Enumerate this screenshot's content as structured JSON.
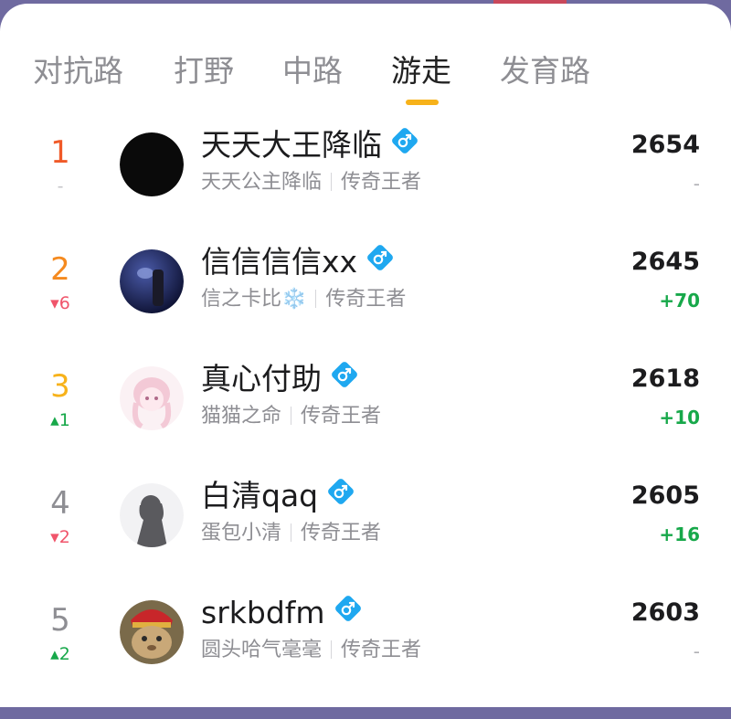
{
  "tabs": [
    {
      "label": "对抗路"
    },
    {
      "label": "打野"
    },
    {
      "label": "中路"
    },
    {
      "label": "游走"
    },
    {
      "label": "发育路"
    }
  ],
  "active_tab": "游走",
  "colors": {
    "rank1": "#f05a28",
    "rank2": "#f58a1f",
    "rank3": "#f7b21a",
    "rank_other": "#8e8e93",
    "up": "#17a84a",
    "down": "#f0556b",
    "verified_badge": "#1fa8f0"
  },
  "players": [
    {
      "rank": "1",
      "trend": "-",
      "trend_dir": "flat",
      "name": "天天大王降临",
      "gender_icon": "male-badge-icon",
      "alias": "天天公主降临",
      "tier": "传奇王者",
      "score": "2654",
      "delta": "-",
      "delta_dir": "flat",
      "avatar": "black-circle"
    },
    {
      "rank": "2",
      "trend": "▾6",
      "trend_dir": "down",
      "name": "信信信信xx",
      "gender_icon": "male-badge-icon",
      "alias": "信之卡比❄️",
      "tier": "传奇王者",
      "score": "2645",
      "delta": "+70",
      "delta_dir": "up",
      "avatar": "dark-blue-photo"
    },
    {
      "rank": "3",
      "trend": "▴1",
      "trend_dir": "up",
      "name": "真心付助",
      "gender_icon": "male-badge-icon",
      "alias": "猫猫之命",
      "tier": "传奇王者",
      "score": "2618",
      "delta": "+10",
      "delta_dir": "up",
      "avatar": "pink-anime-girl"
    },
    {
      "rank": "4",
      "trend": "▾2",
      "trend_dir": "down",
      "name": "白清qaq",
      "gender_icon": "male-badge-icon",
      "alias": "蛋包小清",
      "tier": "传奇王者",
      "score": "2605",
      "delta": "+16",
      "delta_dir": "up",
      "avatar": "silhouette"
    },
    {
      "rank": "5",
      "trend": "▴2",
      "trend_dir": "up",
      "name": "srkbdfm",
      "gender_icon": "male-badge-icon",
      "alias": "圆头哈气毫毫",
      "tier": "传奇王者",
      "score": "2603",
      "delta": "-",
      "delta_dir": "flat",
      "avatar": "cat-with-hat"
    }
  ]
}
